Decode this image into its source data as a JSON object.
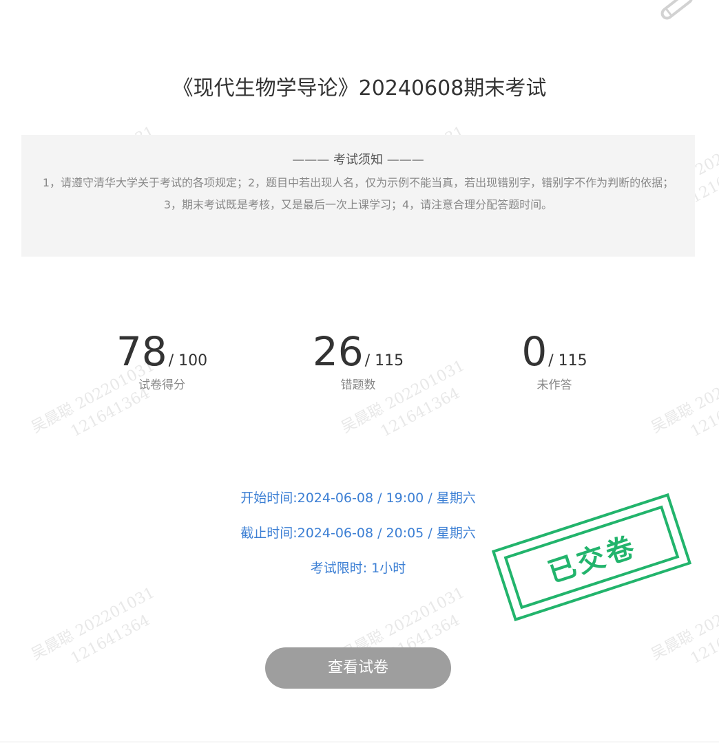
{
  "exam": {
    "title": "《现代生物学导论》20240608期末考试"
  },
  "notice": {
    "heading": "——— 考试须知 ———",
    "body": "1，请遵守清华大学关于考试的各项规定；2，题目中若出现人名，仅为示例不能当真，若出现错别字，错别字不作为判断的依据；3，期末考试既是考核，又是最后一次上课学习；4，请注意合理分配答题时间。"
  },
  "stats": [
    {
      "value": "78",
      "total": "/ 100",
      "label": "试卷得分"
    },
    {
      "value": "26",
      "total": "/ 115",
      "label": "错题数"
    },
    {
      "value": "0",
      "total": "/ 115",
      "label": "未作答"
    }
  ],
  "schedule": {
    "start": "开始时间:2024-06-08 / 19:00 / 星期六",
    "end": "截止时间:2024-06-08 / 20:05 / 星期六",
    "limit": "考试限时: 1小时"
  },
  "stamp": {
    "text": "已交卷",
    "color": "#22b46c"
  },
  "actions": {
    "view_paper": "查看试卷"
  },
  "watermark": {
    "name": "吴晨聪 202201031",
    "id": "121641364"
  },
  "icons": {
    "corner": "pen-icon"
  },
  "colors": {
    "link_blue": "#3c7fd4",
    "button_gray": "#9e9e9e",
    "notice_bg": "#f4f4f4"
  }
}
